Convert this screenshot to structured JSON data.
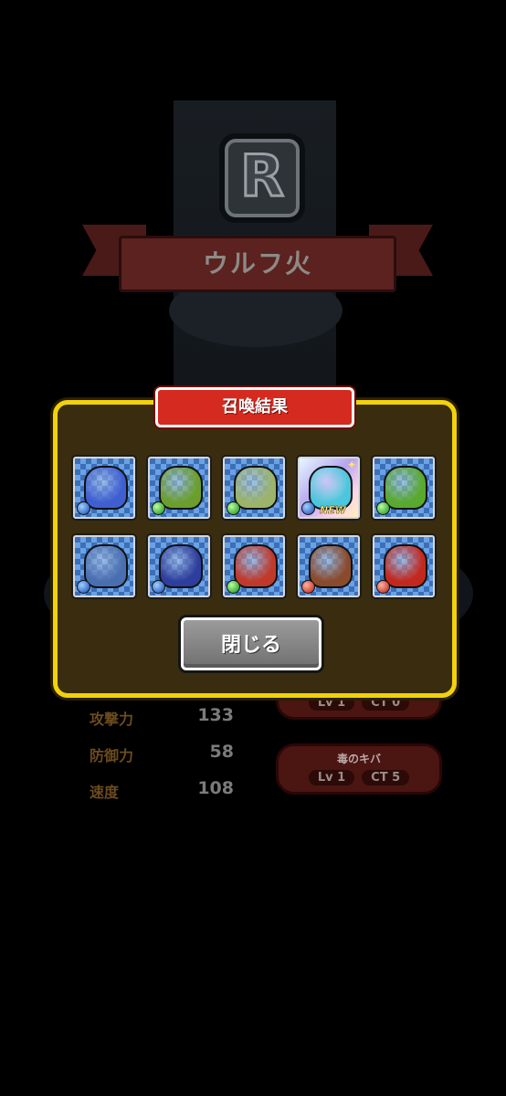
{
  "background": {
    "rank_letter": "R",
    "monster_name": "ウルフ火",
    "stats": [
      {
        "label": "攻撃力",
        "value": "133"
      },
      {
        "label": "防御力",
        "value": "58"
      },
      {
        "label": "速度",
        "value": "108"
      }
    ],
    "skills": [
      {
        "name": "",
        "level": "Lv 1",
        "ct": "CT 0"
      },
      {
        "name": "毒のキバ",
        "level": "Lv 1",
        "ct": "CT 5"
      }
    ]
  },
  "dialog": {
    "title": "召喚結果",
    "close_label": "閉じる",
    "results": [
      {
        "icon": "blue-slug-monster-icon",
        "orb": "blue",
        "body": "#3f5fd0",
        "new": ""
      },
      {
        "icon": "green-slug-monster-icon",
        "orb": "green",
        "body": "#6b9e2c",
        "new": ""
      },
      {
        "icon": "skeleton-warrior-icon",
        "orb": "green",
        "body": "#9bb36b",
        "new": ""
      },
      {
        "icon": "blue-haired-girl-icon",
        "orb": "blue",
        "body": "#4cc6dc",
        "new": "NEW"
      },
      {
        "icon": "treasure-chest-mimic-icon",
        "orb": "green",
        "body": "#58a92e",
        "new": ""
      },
      {
        "icon": "blue-armored-beast-icon",
        "orb": "blue",
        "body": "#4a6fb0",
        "new": ""
      },
      {
        "icon": "blue-golem-icon",
        "orb": "blue",
        "body": "#2e3e9c",
        "new": ""
      },
      {
        "icon": "carnivorous-plant-icon",
        "orb": "green",
        "body": "#c0392b",
        "new": ""
      },
      {
        "icon": "brown-ogre-icon",
        "orb": "red",
        "body": "#8a4b2c",
        "new": ""
      },
      {
        "icon": "red-dragon-icon",
        "orb": "red",
        "body": "#c2281e",
        "new": ""
      }
    ]
  },
  "colors": {
    "dialog_border": "#f1d20c",
    "title_bar": "#d52a1f",
    "button": "#808080"
  }
}
